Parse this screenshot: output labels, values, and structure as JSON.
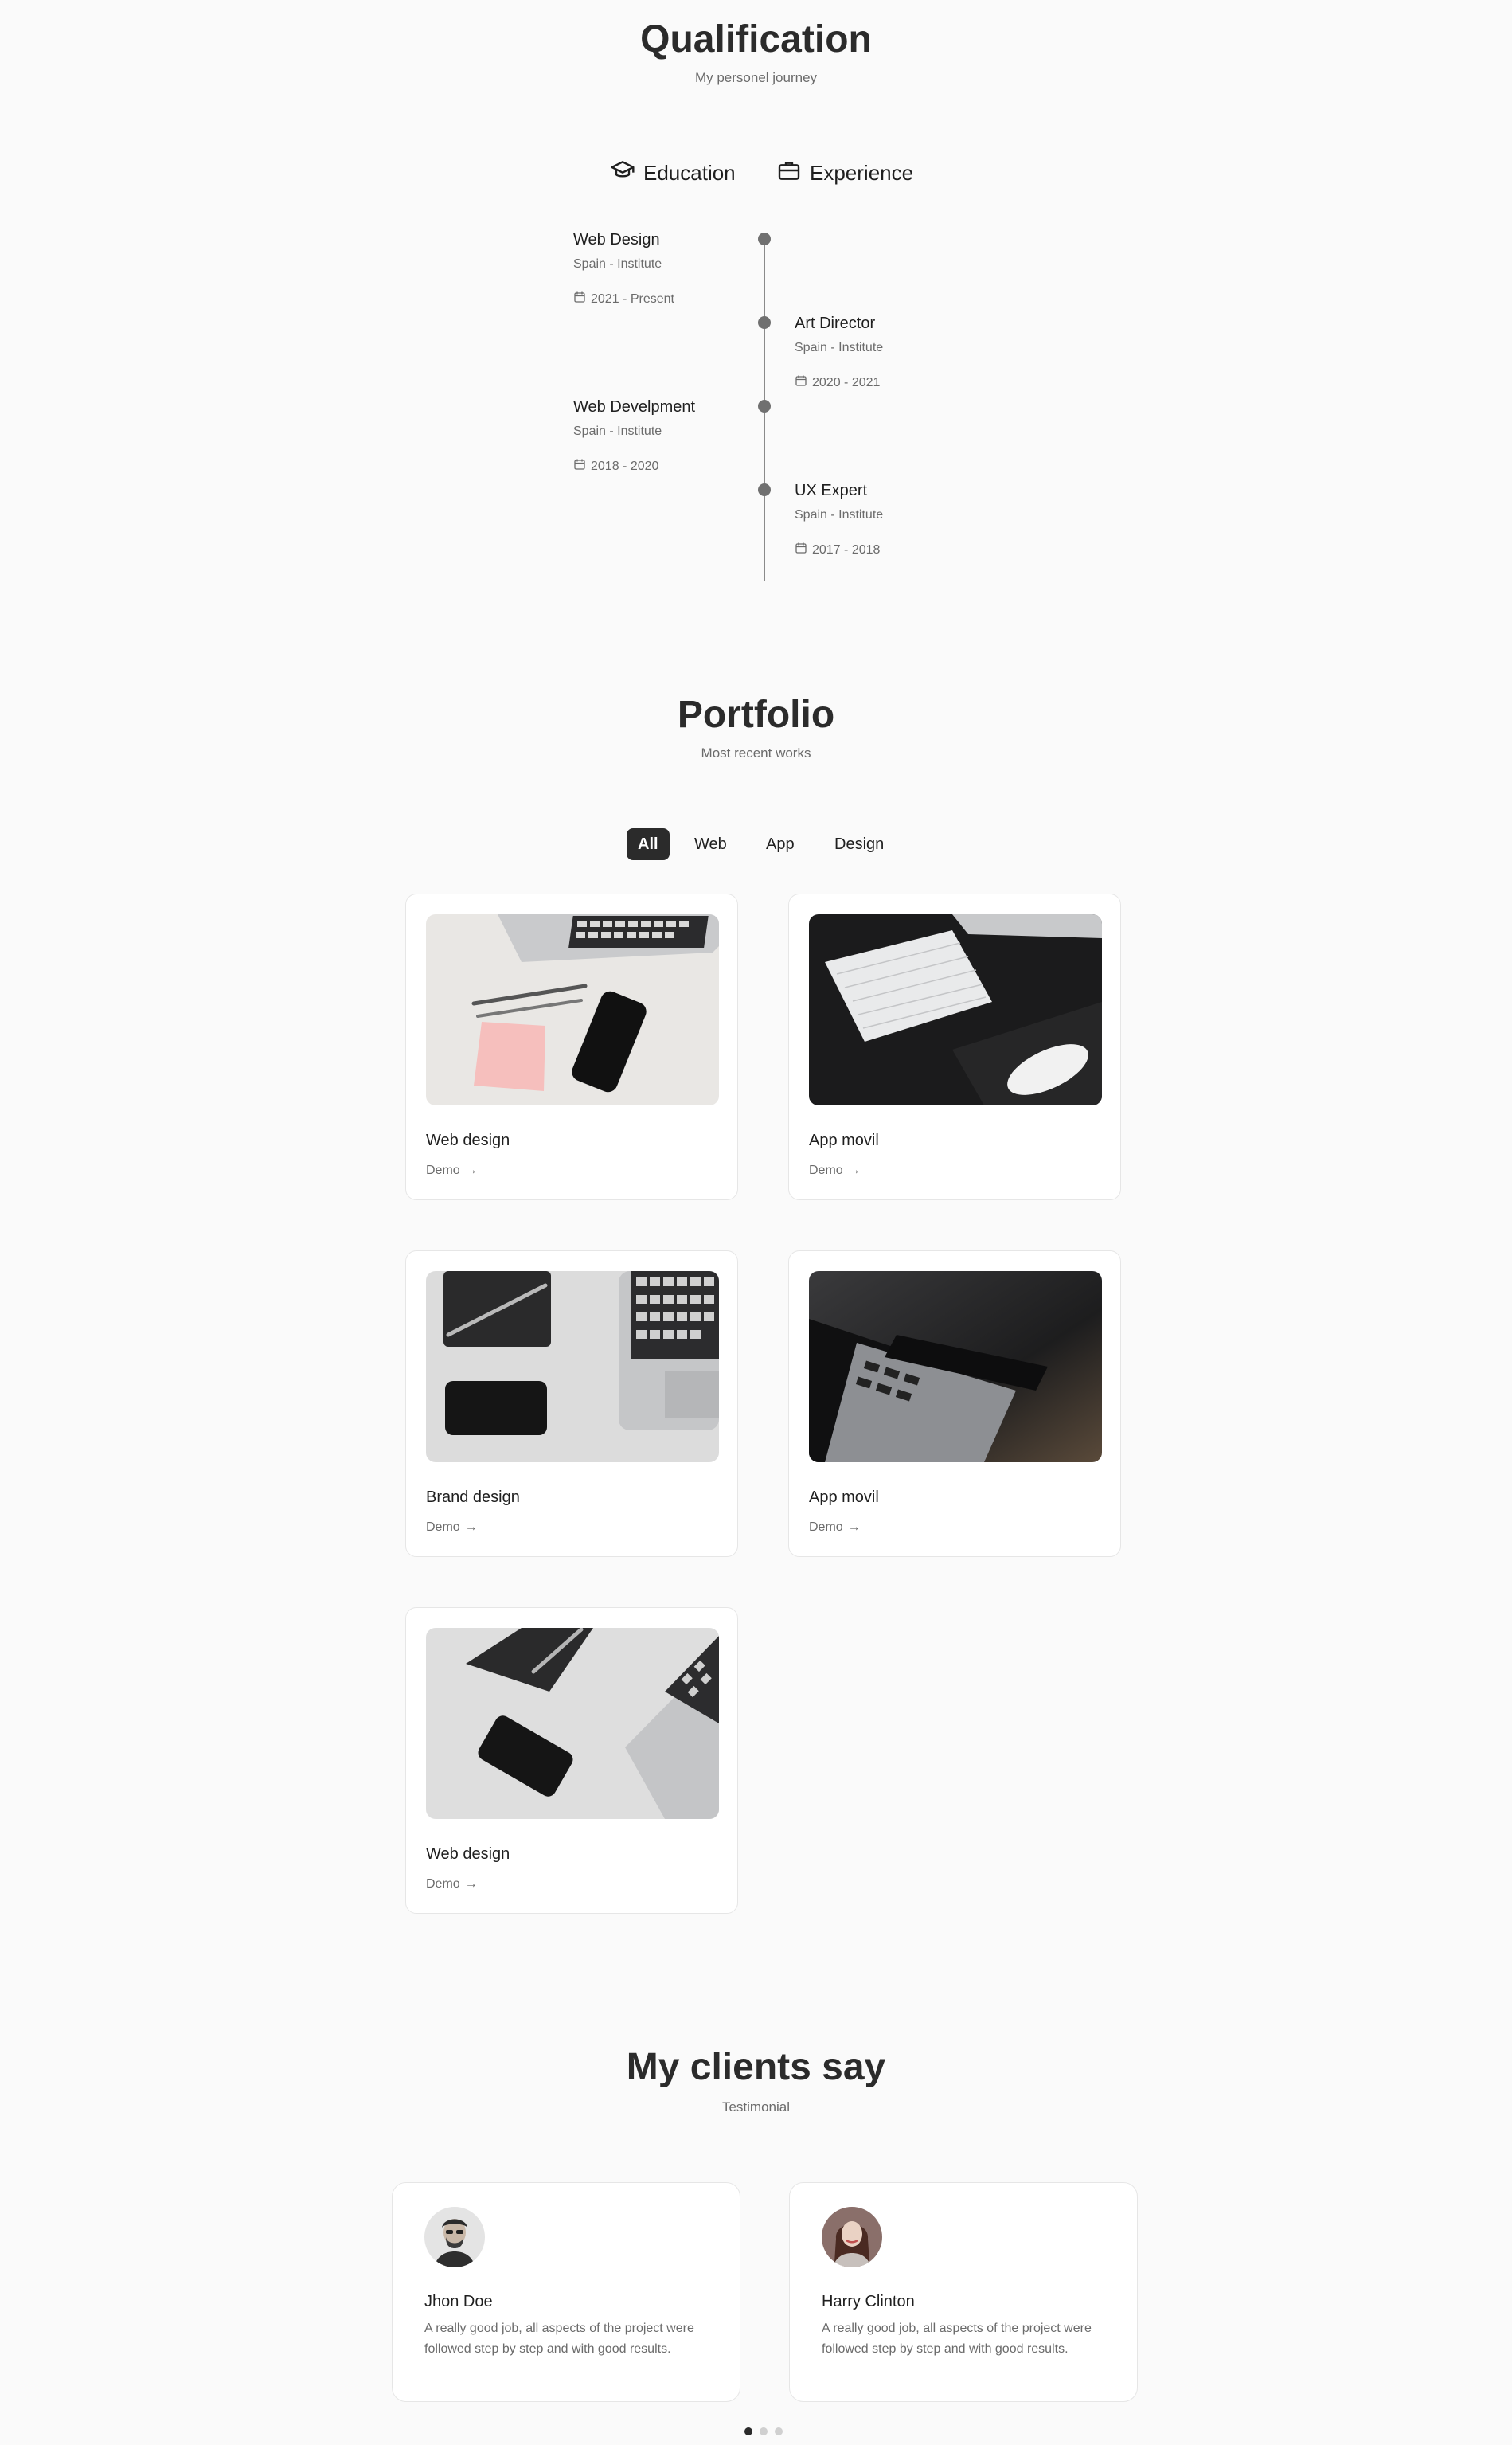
{
  "qualification": {
    "title": "Qualification",
    "subtitle": "My personel journey",
    "tabs": [
      {
        "label": "Education",
        "icon": "graduation-cap-icon"
      },
      {
        "label": "Experience",
        "icon": "briefcase-icon"
      }
    ],
    "timeline": [
      {
        "title": "Web Design",
        "subtitle": "Spain - Institute",
        "date": "2021 - Present"
      },
      {
        "title": "Art Director",
        "subtitle": "Spain - Institute",
        "date": "2020 - 2021"
      },
      {
        "title": "Web Develpment",
        "subtitle": "Spain - Institute",
        "date": "2018 - 2020"
      },
      {
        "title": "UX Expert",
        "subtitle": "Spain - Institute",
        "date": "2017 - 2018"
      }
    ]
  },
  "portfolio": {
    "title": "Portfolio",
    "subtitle": "Most recent works",
    "filters": [
      "All",
      "Web",
      "App",
      "Design"
    ],
    "active_filter": "All",
    "demo_label": "Demo",
    "items": [
      {
        "title": "Web design",
        "image": "desk-laptop-pens-phone-photo"
      },
      {
        "title": "App movil",
        "image": "keyboard-mouse-dark-desk-photo"
      },
      {
        "title": "Brand design",
        "image": "notebook-phone-laptop-photo"
      },
      {
        "title": "App movil",
        "image": "phone-on-laptop-dark-photo"
      },
      {
        "title": "Web design",
        "image": "notebook-phone-laptop-angled-photo"
      }
    ]
  },
  "testimonials": {
    "title": "My clients say",
    "subtitle": "Testimonial",
    "items": [
      {
        "name": "Jhon Doe",
        "text": "A really good job, all aspects of the project were followed step by step and with good results."
      },
      {
        "name": "Harry Clinton",
        "text": "A really good job, all aspects of the project were followed step by step and with good results."
      }
    ],
    "pagination_count": 3,
    "pagination_active": 1
  },
  "colors": {
    "background": "#fafafa",
    "text": "#1f1f1f",
    "muted": "#6b6b6b",
    "accent_dark": "#2b2b2b"
  }
}
